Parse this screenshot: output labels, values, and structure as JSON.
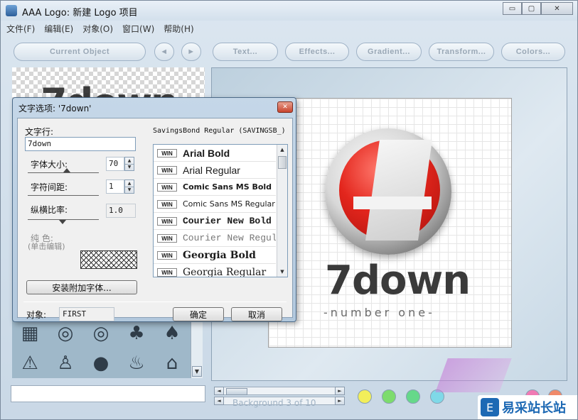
{
  "window": {
    "title": "AAA Logo: 新建 Logo 项目",
    "controls": {
      "minimize": "▭",
      "maximize": "▢",
      "close": "✕"
    }
  },
  "menu": [
    "文件(F)",
    "编辑(E)",
    "对象(O)",
    "窗口(W)",
    "帮助(H)"
  ],
  "toolbar": {
    "current_object": "Current Object",
    "prev": "◄",
    "next": "►",
    "text": "Text...",
    "effects": "Effects...",
    "gradient": "Gradient...",
    "transform": "Transform...",
    "colors": "Colors..."
  },
  "dialog": {
    "title": "文字选项: '7down'",
    "text_line_label": "文字行:",
    "text_line_value": "7down",
    "font_size_label": "字体大小:",
    "font_size_value": "70",
    "char_spacing_label": "字符间距:",
    "char_spacing_value": "1",
    "aspect_label": "纵横比率:",
    "aspect_value": "1.0",
    "solid_color_label": "纯 色:",
    "solid_color_hint": "(单击编辑)",
    "install_fonts_button": "安装附加字体...",
    "font_current": "SavingsBond Regular (SAVINGSB_)",
    "fonts": [
      {
        "tag": "WIN",
        "name": "Arial Bold"
      },
      {
        "tag": "WIN",
        "name": "Arial Regular"
      },
      {
        "tag": "WIN",
        "name": "Comic Sans MS Bold"
      },
      {
        "tag": "WIN",
        "name": "Comic Sans MS Regular"
      },
      {
        "tag": "WIN",
        "name": "Courier New Bold"
      },
      {
        "tag": "WIN",
        "name": "Courier New Regular"
      },
      {
        "tag": "WIN",
        "name": "Georgia Bold"
      },
      {
        "tag": "WIN",
        "name": "Georgia Regular"
      }
    ],
    "object_label": "对象:",
    "object_value": "FIRST",
    "ok_button": "确定",
    "cancel_button": "取消"
  },
  "canvas": {
    "logo_word": "7down",
    "logo_tagline": "-number one-"
  },
  "preview_text": "7down",
  "status_faint": "Background  3 of 10",
  "swatches": [
    "#f2ee5a",
    "#7ddc6d",
    "#66d88a",
    "#7fd9e8",
    "#d9d2ee",
    "#f07ab4",
    "#f08a6a"
  ],
  "brand": {
    "badge_text": "易采站长站"
  }
}
